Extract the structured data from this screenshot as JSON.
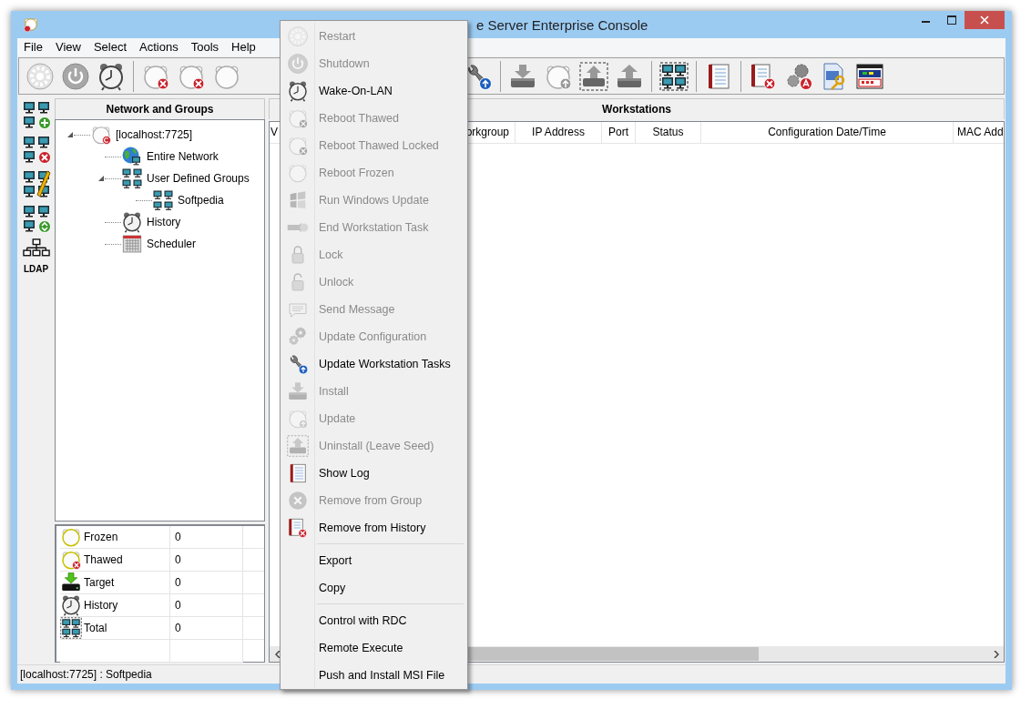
{
  "window": {
    "title": "e Server Enterprise Console"
  },
  "menu_bar": [
    "File",
    "View",
    "Select",
    "Actions",
    "Tools",
    "Help"
  ],
  "side_toolbar": {
    "ldap_label": "LDAP"
  },
  "network_panel": {
    "title": "Network and Groups",
    "tree": [
      {
        "label": "[localhost:7725]",
        "kind": "server",
        "expanded": true,
        "children": [
          {
            "label": "Entire Network",
            "kind": "network"
          },
          {
            "label": "User Defined Groups",
            "kind": "groups",
            "expanded": true,
            "children": [
              {
                "label": "Softpedia",
                "kind": "group"
              }
            ]
          },
          {
            "label": "History",
            "kind": "history"
          },
          {
            "label": "Scheduler",
            "kind": "scheduler"
          }
        ]
      }
    ]
  },
  "stats": [
    {
      "label": "Frozen",
      "count": "0"
    },
    {
      "label": "Thawed",
      "count": "0"
    },
    {
      "label": "Target",
      "count": "0"
    },
    {
      "label": "History",
      "count": "0"
    },
    {
      "label": "Total",
      "count": "0"
    }
  ],
  "workstations": {
    "title": "Workstations",
    "columns": [
      "V",
      "orkgroup",
      "IP Address",
      "Port",
      "Status",
      "Configuration Date/Time",
      "MAC Add"
    ]
  },
  "context_menu": [
    {
      "label": "Restart",
      "disabled": true
    },
    {
      "label": "Shutdown",
      "disabled": true
    },
    {
      "label": "Wake-On-LAN",
      "disabled": false
    },
    {
      "label": "Reboot Thawed",
      "disabled": true
    },
    {
      "label": "Reboot Thawed Locked",
      "disabled": true
    },
    {
      "label": "Reboot Frozen",
      "disabled": true
    },
    {
      "label": "Run Windows Update",
      "disabled": true
    },
    {
      "label": "End Workstation Task",
      "disabled": true
    },
    {
      "label": "Lock",
      "disabled": true
    },
    {
      "label": "Unlock",
      "disabled": true
    },
    {
      "label": "Send Message",
      "disabled": true
    },
    {
      "label": "Update Configuration",
      "disabled": true
    },
    {
      "label": "Update Workstation Tasks",
      "disabled": false
    },
    {
      "label": "Install",
      "disabled": true
    },
    {
      "label": "Update",
      "disabled": true
    },
    {
      "label": "Uninstall (Leave Seed)",
      "disabled": true
    },
    {
      "label": "Show Log",
      "disabled": false
    },
    {
      "label": "Remove from Group",
      "disabled": true
    },
    {
      "label": "Remove from History",
      "disabled": false
    },
    {
      "kind": "separator"
    },
    {
      "label": "Export",
      "disabled": false
    },
    {
      "label": "Copy",
      "disabled": false
    },
    {
      "kind": "separator"
    },
    {
      "label": "Control with RDC",
      "disabled": false
    },
    {
      "label": "Remote Execute",
      "disabled": false
    },
    {
      "label": "Push and Install MSI File",
      "disabled": false
    }
  ],
  "status_bar": "[localhost:7725] : Softpedia"
}
